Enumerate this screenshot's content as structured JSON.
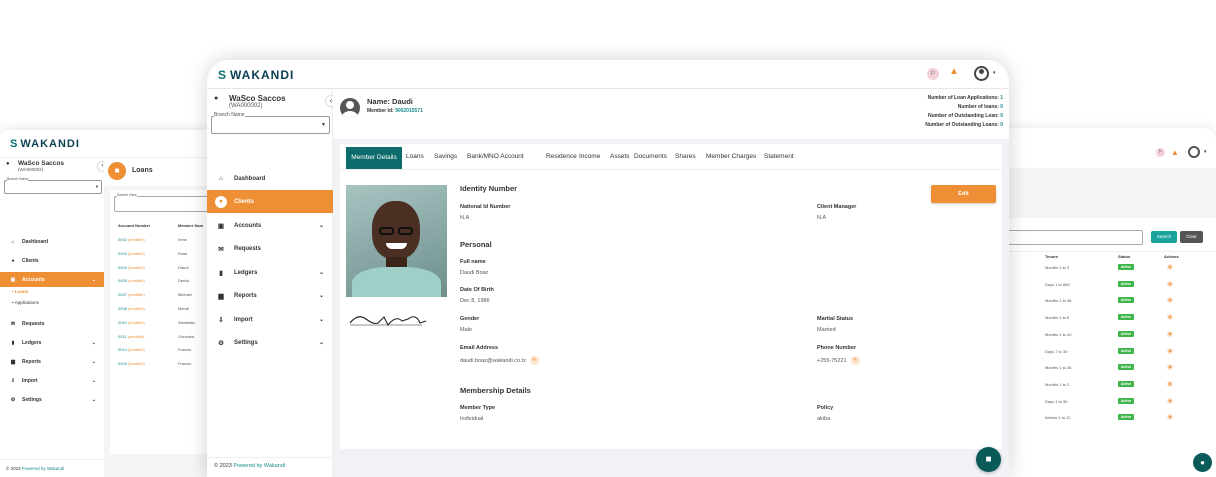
{
  "brand": {
    "name": "WAKANDI",
    "mark": "S"
  },
  "left_window": {
    "org_name": "WaSco Saccos",
    "org_code": "(WA000002)",
    "branch_label": "Branch Name",
    "page_title": "Loans",
    "search_label": "Search Here",
    "nav": [
      {
        "label": "Dashboard",
        "icon": "home-icon"
      },
      {
        "label": "Clients",
        "icon": "user-icon"
      },
      {
        "label": "Accounts",
        "icon": "wallet-icon"
      },
      {
        "label": "Requests",
        "icon": "envelope-icon"
      },
      {
        "label": "Ledgers",
        "icon": "book-icon"
      },
      {
        "label": "Reports",
        "icon": "bar-chart-icon"
      },
      {
        "label": "Import",
        "icon": "import-icon"
      },
      {
        "label": "Settings",
        "icon": "gear-icon"
      }
    ],
    "sub_nav": [
      "Loans",
      "Applications"
    ],
    "table_headers": [
      "Account Number",
      "Member Nam"
    ],
    "rows": [
      {
        "acc": "0002",
        "tag": "(credible)",
        "name": "Irene"
      },
      {
        "acc": "0003",
        "tag": "(credible)",
        "name": "Rose"
      },
      {
        "acc": "0004",
        "tag": "(credible)",
        "name": "Daudi"
      },
      {
        "acc": "0005",
        "tag": "(credible)",
        "name": "Derick"
      },
      {
        "acc": "0007",
        "tag": "(credible)",
        "name": "Michael"
      },
      {
        "acc": "0008",
        "tag": "(credible)",
        "name": "Mehdi"
      },
      {
        "acc": "0010",
        "tag": "(credible)",
        "name": "Weinbala"
      },
      {
        "acc": "0011",
        "tag": "(credible)",
        "name": "Gonomia"
      },
      {
        "acc": "0014",
        "tag": "(credible)",
        "name": "Francis"
      },
      {
        "acc": "0003",
        "tag": "(credible)",
        "name": "Francis"
      }
    ],
    "footer_year": "© 2023",
    "footer_powered": "Powered by Wakandi"
  },
  "right_window": {
    "search_btn": "Search",
    "clear_btn": "Clear",
    "headers": [
      "Tenure",
      "Status",
      "Actions"
    ],
    "rows": [
      {
        "tenure": "Months 1 to 3",
        "status": "Active"
      },
      {
        "tenure": "Days 1 to 660",
        "status": "Active"
      },
      {
        "tenure": "Months 1 to 36",
        "status": "Active"
      },
      {
        "tenure": "Months 1 to 5",
        "status": "Active"
      },
      {
        "tenure": "Months 1 to 40",
        "status": "Active"
      },
      {
        "tenure": "Days 7 to 30",
        "status": "Active"
      },
      {
        "tenure": "Months 1 to 36",
        "status": "Active"
      },
      {
        "tenure": "Months 1 to 2",
        "status": "Active"
      },
      {
        "tenure": "Days 1 to 30",
        "status": "Active"
      },
      {
        "tenure": "Weeks 1 to 12",
        "status": "Active"
      }
    ]
  },
  "main_window": {
    "org_name": "WaSco Saccos",
    "org_code": "(WA000002)",
    "branch_label": "Branch Name",
    "nav": [
      {
        "label": "Dashboard",
        "icon": "home-icon"
      },
      {
        "label": "Clients",
        "icon": "user-icon"
      },
      {
        "label": "Accounts",
        "icon": "wallet-icon"
      },
      {
        "label": "Requests",
        "icon": "envelope-icon"
      },
      {
        "label": "Ledgers",
        "icon": "book-icon"
      },
      {
        "label": "Reports",
        "icon": "bar-chart-icon"
      },
      {
        "label": "Import",
        "icon": "import-icon"
      },
      {
        "label": "Settings",
        "icon": "gear-icon"
      }
    ],
    "footer_year": "© 2023",
    "footer_powered": "Powered by Wakandi",
    "member": {
      "name_label": "Name:",
      "name": "Daudi",
      "id_label": "Member Id:",
      "id": "9002015571"
    },
    "stats": [
      {
        "label": "Number of Loan Applications:",
        "value": "1"
      },
      {
        "label": "Number of loans:",
        "value": "0"
      },
      {
        "label": "Number of Outstanding Loan:",
        "value": "0"
      },
      {
        "label": "Number of Outstanding Loans:",
        "value": "0"
      }
    ],
    "tabs": [
      "Member Details",
      "Loans",
      "Savings",
      "Bank/MNO Account",
      "Residence",
      "Income",
      "Assets",
      "Documents",
      "Shares",
      "Member Charges",
      "Statement"
    ],
    "edit_btn": "Edit",
    "identity": {
      "heading": "Identity Number",
      "national_label": "National Id Number",
      "national_value": "N.A",
      "manager_label": "Client Manager",
      "manager_value": "N.A"
    },
    "personal": {
      "heading": "Personal",
      "fullname_label": "Full name",
      "fullname_value": "Daudi Boaz",
      "dob_label": "Date Of Birth",
      "dob_value": "Dec 8, 1986",
      "gender_label": "Gender",
      "gender_value": "Male",
      "marital_label": "Marital Status",
      "marital_value": "Married",
      "email_label": "Email Address",
      "email_value": "daudi.boaz@wakandi.co.tz",
      "phone_label": "Phone Number",
      "phone_value": "+255-75221"
    },
    "membership": {
      "heading": "Membership Details",
      "type_label": "Member Type",
      "type_value": "Individual",
      "policy_label": "Policy",
      "policy_value": "akiba"
    }
  },
  "colors": {
    "accent": "#ee8f35",
    "teal": "#1b8a8a",
    "navy": "#0b3f52",
    "green": "#3fb44a"
  }
}
